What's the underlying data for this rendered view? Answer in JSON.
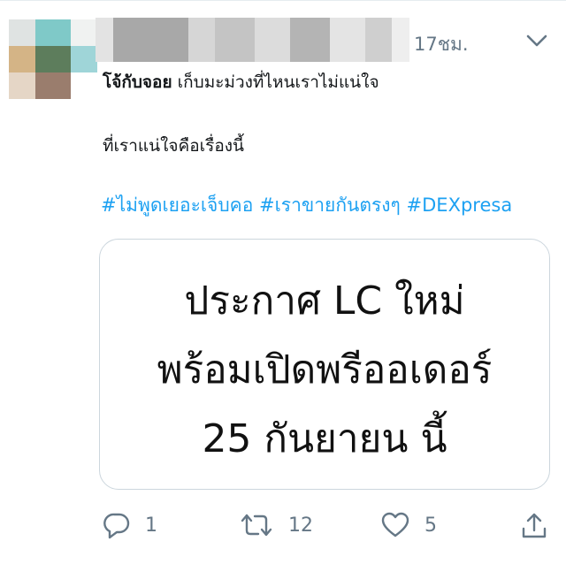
{
  "tweet": {
    "time": "17ชม.",
    "author_name": "โจ้กับจอย",
    "text_line1": "เก็บมะม่วงที่ไหนเราไม่แน่ใจ",
    "text_line2": "ที่เราแน่ใจคือเรื่องนี้",
    "hashtags": [
      "#ไม่พูดเยอะเจ็บคอ",
      "#เราขายกันตรงๆ",
      "#DEXpresa"
    ]
  },
  "card": {
    "lines": [
      "ประกาศ LC ใหม่",
      "พร้อมเปิดพรีออเดอร์",
      "25 กันยายน นี้"
    ]
  },
  "actions": {
    "reply_count": "1",
    "retweet_count": "12",
    "like_count": "5"
  },
  "icons": {
    "more": "chevron-down-icon",
    "reply": "reply-icon",
    "retweet": "retweet-icon",
    "like": "heart-icon",
    "share": "share-icon"
  },
  "colors": {
    "hashtag": "#1da1f2",
    "secondary_text": "#657786",
    "border": "#ccd6dd"
  }
}
